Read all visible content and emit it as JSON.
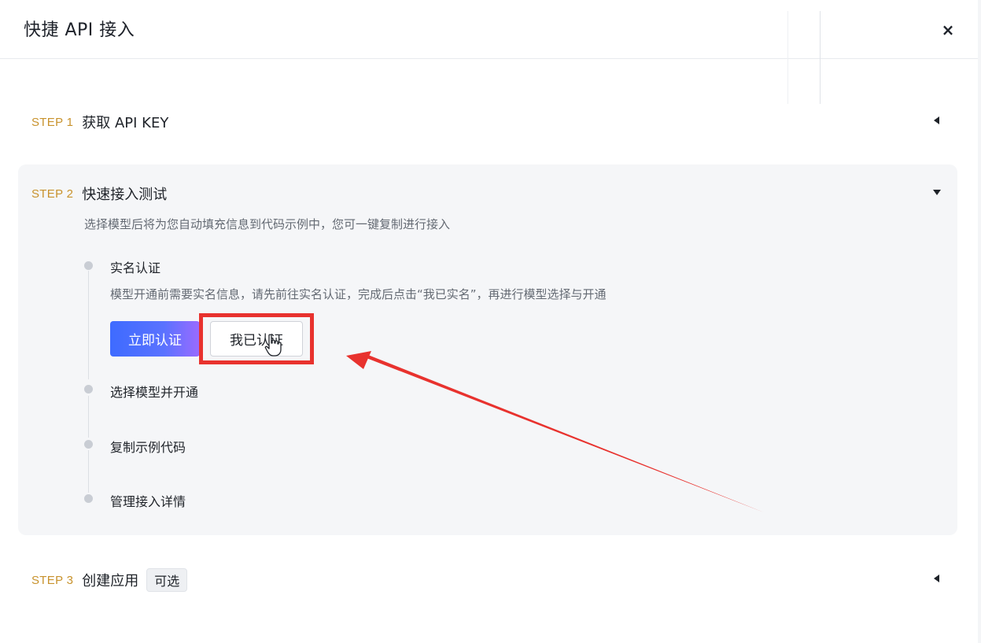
{
  "header": {
    "title": "快捷 API 接入",
    "close_symbol": "×"
  },
  "steps": [
    {
      "no": "STEP 1",
      "title": "获取 API KEY",
      "state": "collapsed"
    },
    {
      "no": "STEP 2",
      "title": "快速接入测试",
      "state": "expanded",
      "description": "选择模型后将为您自动填充信息到代码示例中，您可一键复制进行接入"
    },
    {
      "no": "STEP 3",
      "title": "创建应用",
      "tag": "可选",
      "state": "collapsed"
    }
  ],
  "timeline": {
    "items": [
      {
        "label": "实名认证",
        "description": "模型开通前需要实名信息，请先前往实名认证，完成后点击“我已实名”，再进行模型选择与开通"
      },
      {
        "label": "选择模型并开通"
      },
      {
        "label": "复制示例代码"
      },
      {
        "label": "管理接入详情"
      }
    ],
    "primary_button": "立即认证",
    "secondary_button": "我已认证"
  },
  "colors": {
    "step_accent": "#c8922c",
    "primary_gradient_start": "#3e6bff",
    "primary_gradient_end": "#9a6bff",
    "annotation_red": "#e8322e",
    "panel_bg": "#f5f6f8"
  },
  "icons": {
    "close": "close-icon",
    "collapsed": "caret-left-icon",
    "expanded": "caret-down-icon",
    "pointer": "hand-pointer-icon"
  }
}
